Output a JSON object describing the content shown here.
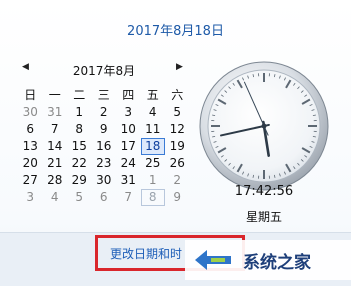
{
  "header": {
    "full_date": "2017年8月18日"
  },
  "calendar": {
    "month_title": "2017年8月",
    "prev_icon": "triangle-left-icon",
    "next_icon": "triangle-right-icon",
    "weekdays": [
      "日",
      "一",
      "二",
      "三",
      "四",
      "五",
      "六"
    ],
    "weeks": [
      [
        "30",
        "31",
        "1",
        "2",
        "3",
        "4",
        "5"
      ],
      [
        "6",
        "7",
        "8",
        "9",
        "10",
        "11",
        "12"
      ],
      [
        "13",
        "14",
        "15",
        "16",
        "17",
        "18",
        "19"
      ],
      [
        "20",
        "21",
        "22",
        "23",
        "24",
        "25",
        "26"
      ],
      [
        "27",
        "28",
        "29",
        "30",
        "31",
        "1",
        "2"
      ],
      [
        "3",
        "4",
        "5",
        "6",
        "7",
        "8",
        "9"
      ]
    ],
    "selected_day": "18"
  },
  "clock": {
    "hours": 17,
    "minutes": 42,
    "seconds": 56,
    "time_text": "17:42:56",
    "weekday_text": "星期五"
  },
  "footer": {
    "change_link": "更改日期和时"
  },
  "watermark": {
    "text": "系统之家",
    "icon": "system-home-logo-icon"
  },
  "colors": {
    "accent": "#1e5aa8",
    "highlight": "#d9262c"
  }
}
